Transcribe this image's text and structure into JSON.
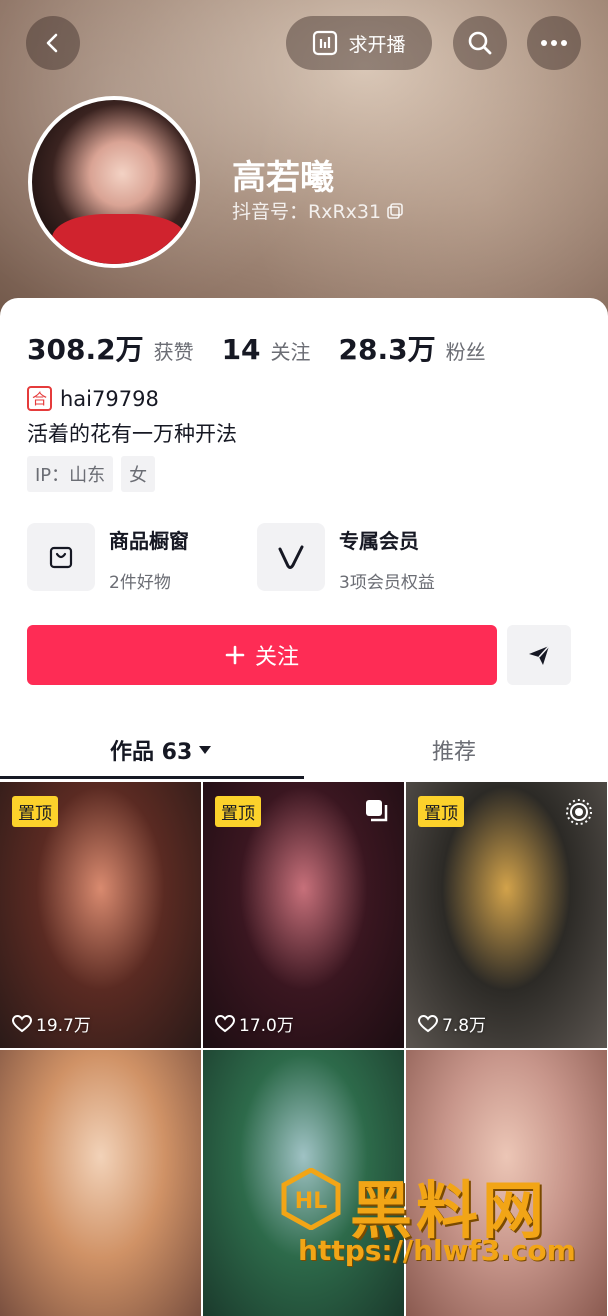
{
  "header": {
    "request_live_label": "求开播",
    "name": "高若曦",
    "douyin_id": "抖音号：RxRx31"
  },
  "stats": [
    {
      "value": "308.2万",
      "label": "获赞"
    },
    {
      "value": "14",
      "label": "关注"
    },
    {
      "value": "28.3万",
      "label": "粉丝"
    }
  ],
  "profile": {
    "handle_badge": "合",
    "handle": "hai79798",
    "bio": "活着的花有一万种开法",
    "tags": [
      "IP：山东",
      "女"
    ]
  },
  "features": [
    {
      "title": "商品橱窗",
      "subtitle": "2件好物",
      "icon": "shopping-bag-icon"
    },
    {
      "title": "专属会员",
      "subtitle": "3项会员权益",
      "icon": "vip-v-icon"
    }
  ],
  "actions": {
    "follow_label": "关注"
  },
  "tabs": {
    "works_label": "作品 63",
    "recommend_label": "推荐"
  },
  "videos": [
    {
      "pinned": "置顶",
      "likes": "19.7万",
      "colors": [
        "#5a2a22",
        "#d98a6f",
        "#2a1a18"
      ]
    },
    {
      "pinned": "置顶",
      "likes": "17.0万",
      "colors": [
        "#3a1620",
        "#c7707a",
        "#1c0d12"
      ]
    },
    {
      "pinned": "置顶",
      "likes": "7.8万",
      "colors": [
        "#2c2a26",
        "#d2a24a",
        "#5b5550"
      ]
    },
    {
      "pinned": "",
      "likes": "",
      "colors": [
        "#d09266",
        "#f2d2b8",
        "#7a5040"
      ]
    },
    {
      "pinned": "",
      "likes": "",
      "colors": [
        "#2d6a4a",
        "#9fc2c4",
        "#1b3a2c"
      ]
    },
    {
      "pinned": "",
      "likes": "",
      "colors": [
        "#c7958a",
        "#ecc6b6",
        "#8a5a50"
      ]
    }
  ],
  "watermark": {
    "title": "黑料网",
    "url": "https://hlwf3.com"
  }
}
